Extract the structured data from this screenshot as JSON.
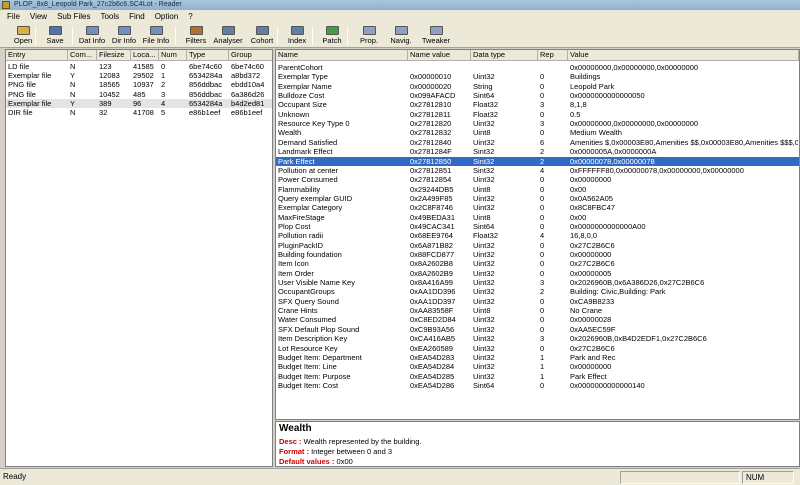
{
  "window": {
    "title": "PLOP_8x8_Leopold Park_27c2b6c6.SC4Lot - Reader"
  },
  "menu": [
    "File",
    "View",
    "Sub Files",
    "Tools",
    "Find",
    "Option",
    "?"
  ],
  "toolbar": [
    {
      "label": "Open",
      "icon": "folder-open-icon",
      "color": "#d8b040"
    },
    {
      "label": "Save",
      "icon": "floppy-icon",
      "color": "#5070b0"
    },
    {
      "label": "Dat Info",
      "icon": "dat-info-icon",
      "color": "#7090c0"
    },
    {
      "label": "Dir Info",
      "icon": "dir-info-icon",
      "color": "#7090c0"
    },
    {
      "label": "File Info",
      "icon": "file-info-icon",
      "color": "#7090c0"
    },
    {
      "label": "Filters",
      "icon": "filter-icon",
      "color": "#b07030"
    },
    {
      "label": "Analyser",
      "icon": "analyser-icon",
      "color": "#6080a0"
    },
    {
      "label": "Cohort",
      "icon": "cohort-icon",
      "color": "#6080a0"
    },
    {
      "label": "Index",
      "icon": "index-icon",
      "color": "#6080a0"
    },
    {
      "label": "Patch",
      "icon": "patch-icon",
      "color": "#40a040"
    },
    {
      "label": "Prop.",
      "icon": "properties-icon",
      "color": "#90a0c0"
    },
    {
      "label": "Navig.",
      "icon": "navigator-icon",
      "color": "#90a0c0"
    },
    {
      "label": "Tweaker",
      "icon": "tweaker-icon",
      "color": "#90a0c0"
    }
  ],
  "entries": {
    "headers": [
      "Entry",
      "Com...",
      "Filesize",
      "Loca...",
      "Num",
      "Type",
      "Group"
    ],
    "rows": [
      [
        "LD file",
        "N",
        "123",
        "41585",
        "0",
        "6be74c60",
        "6be74c60"
      ],
      [
        "Exemplar file",
        "Y",
        "12083",
        "29502",
        "1",
        "6534284a",
        "a8bd372"
      ],
      [
        "PNG file",
        "N",
        "18565",
        "10937",
        "2",
        "856ddbac",
        "ebdd10a4"
      ],
      [
        "PNG file",
        "N",
        "10452",
        "485",
        "3",
        "856ddbac",
        "6a386d26"
      ],
      [
        "Exemplar file",
        "Y",
        "389",
        "96",
        "4",
        "6534284a",
        "b4d2ed81"
      ],
      [
        "DIR file",
        "N",
        "32",
        "41708",
        "5",
        "e86b1eef",
        "e86b1eef"
      ]
    ],
    "highlight_row": 4
  },
  "properties": {
    "headers": [
      "Name",
      "Name value",
      "Data type",
      "Rep",
      "Value"
    ],
    "selected_row": 10,
    "rows": [
      [
        "ParentCohort",
        "",
        "",
        "",
        "0x00000000,0x00000000,0x00000000"
      ],
      [
        "Exemplar Type",
        "0x00000010",
        "Uint32",
        "0",
        "Buildings"
      ],
      [
        "Exemplar Name",
        "0x00000020",
        "String",
        "0",
        "Leopold Park"
      ],
      [
        "Bulldoze Cost",
        "0x099AFACD",
        "Sint64",
        "0",
        "0x0000000000000050"
      ],
      [
        "Occupant Size",
        "0x27812810",
        "Float32",
        "3",
        "8,1,8"
      ],
      [
        "Unknown",
        "0x27812811",
        "Float32",
        "0",
        "0.5"
      ],
      [
        "Resource Key Type 0",
        "0x27812820",
        "Uint32",
        "3",
        "0x00000000,0x00000000,0x00000000"
      ],
      [
        "Wealth",
        "0x27812832",
        "Uint8",
        "0",
        "Medium Wealth"
      ],
      [
        "Demand Satisfied",
        "0x27812840",
        "Uint32",
        "6",
        "Amenities $,0x00003E80,Amenities $$,0x00003E80,Amenities $$$,0x00..."
      ],
      [
        "Landmark Effect",
        "0x2781284F",
        "Sint32",
        "2",
        "0x0000005A,0x0000000A"
      ],
      [
        "Park Effect",
        "0x27812850",
        "Sint32",
        "2",
        "0x00000078,0x00000078"
      ],
      [
        "Pollution at center",
        "0x27812851",
        "Sint32",
        "4",
        "0xFFFFFF80,0x00000078,0x00000000,0x00000000"
      ],
      [
        "Power Consumed",
        "0x27812854",
        "Uint32",
        "0",
        "0x00000000"
      ],
      [
        "Flammability",
        "0x29244DB5",
        "Uint8",
        "0",
        "0x00"
      ],
      [
        "Query exemplar GUID",
        "0x2A499F85",
        "Uint32",
        "0",
        "0x0A562A05"
      ],
      [
        "Exemplar Category",
        "0x2C8F8746",
        "Uint32",
        "0",
        "0x8C8FBC47"
      ],
      [
        "MaxFireStage",
        "0x49BEDA31",
        "Uint8",
        "0",
        "0x00"
      ],
      [
        "Plop Cost",
        "0x49CAC341",
        "Sint64",
        "0",
        "0x0000000000000A00"
      ],
      [
        "Pollution radii",
        "0x68EE9764",
        "Float32",
        "4",
        "16,8,0,0"
      ],
      [
        "PluginPackID",
        "0x6A871B82",
        "Uint32",
        "0",
        "0x27C2B6C6"
      ],
      [
        "Building foundation",
        "0x88FCD877",
        "Uint32",
        "0",
        "0x00000000"
      ],
      [
        "Item Icon",
        "0x8A2602B8",
        "Uint32",
        "0",
        "0x27C2B6C6"
      ],
      [
        "Item Order",
        "0x8A2602B9",
        "Uint32",
        "0",
        "0x00000005"
      ],
      [
        "User Visible Name Key",
        "0x8A416A99",
        "Uint32",
        "3",
        "0x2026960B,0x6A386D26,0x27C2B6C6"
      ],
      [
        "OccupantGroups",
        "0xAA1DD396",
        "Uint32",
        "2",
        "Building: Civic,Building: Park"
      ],
      [
        "SFX Query Sound",
        "0xAA1DD397",
        "Uint32",
        "0",
        "0xCA9B8233"
      ],
      [
        "Crane Hints",
        "0xAA83558F",
        "Uint8",
        "0",
        "No Crane"
      ],
      [
        "Water Consumed",
        "0xC8ED2D84",
        "Uint32",
        "0",
        "0x00000028"
      ],
      [
        "SFX Default Plop Sound",
        "0xC9B93A56",
        "Uint32",
        "0",
        "0xAA5EC59F"
      ],
      [
        "Item Description Key",
        "0xCA416AB5",
        "Uint32",
        "3",
        "0x2026960B,0xB4D2EDF1,0x27C2B6C6"
      ],
      [
        "Lot Resource Key",
        "0xEA260589",
        "Uint32",
        "0",
        "0x27C2B6C6"
      ],
      [
        "Budget Item: Department",
        "0xEA54D283",
        "Uint32",
        "1",
        "Park and Rec"
      ],
      [
        "Budget Item: Line",
        "0xEA54D284",
        "Uint32",
        "1",
        "0x00000000"
      ],
      [
        "Budget Item: Purpose",
        "0xEA54D285",
        "Uint32",
        "1",
        "Park Effect"
      ],
      [
        "Budget Item: Cost",
        "0xEA54D286",
        "Sint64",
        "0",
        "0x0000000000000140"
      ]
    ]
  },
  "description": {
    "title": "Wealth",
    "desc_label": "Desc :",
    "desc_text": "Wealth represented by the building.",
    "format_label": "Format :",
    "format_text": "Integer between 0 and 3",
    "default_label": "Default values :",
    "default_text": "0x00"
  },
  "status": {
    "text": "Ready",
    "num": "NUM"
  },
  "colors": {
    "selection": "#316ac5",
    "desc_label": "#cc0000"
  }
}
